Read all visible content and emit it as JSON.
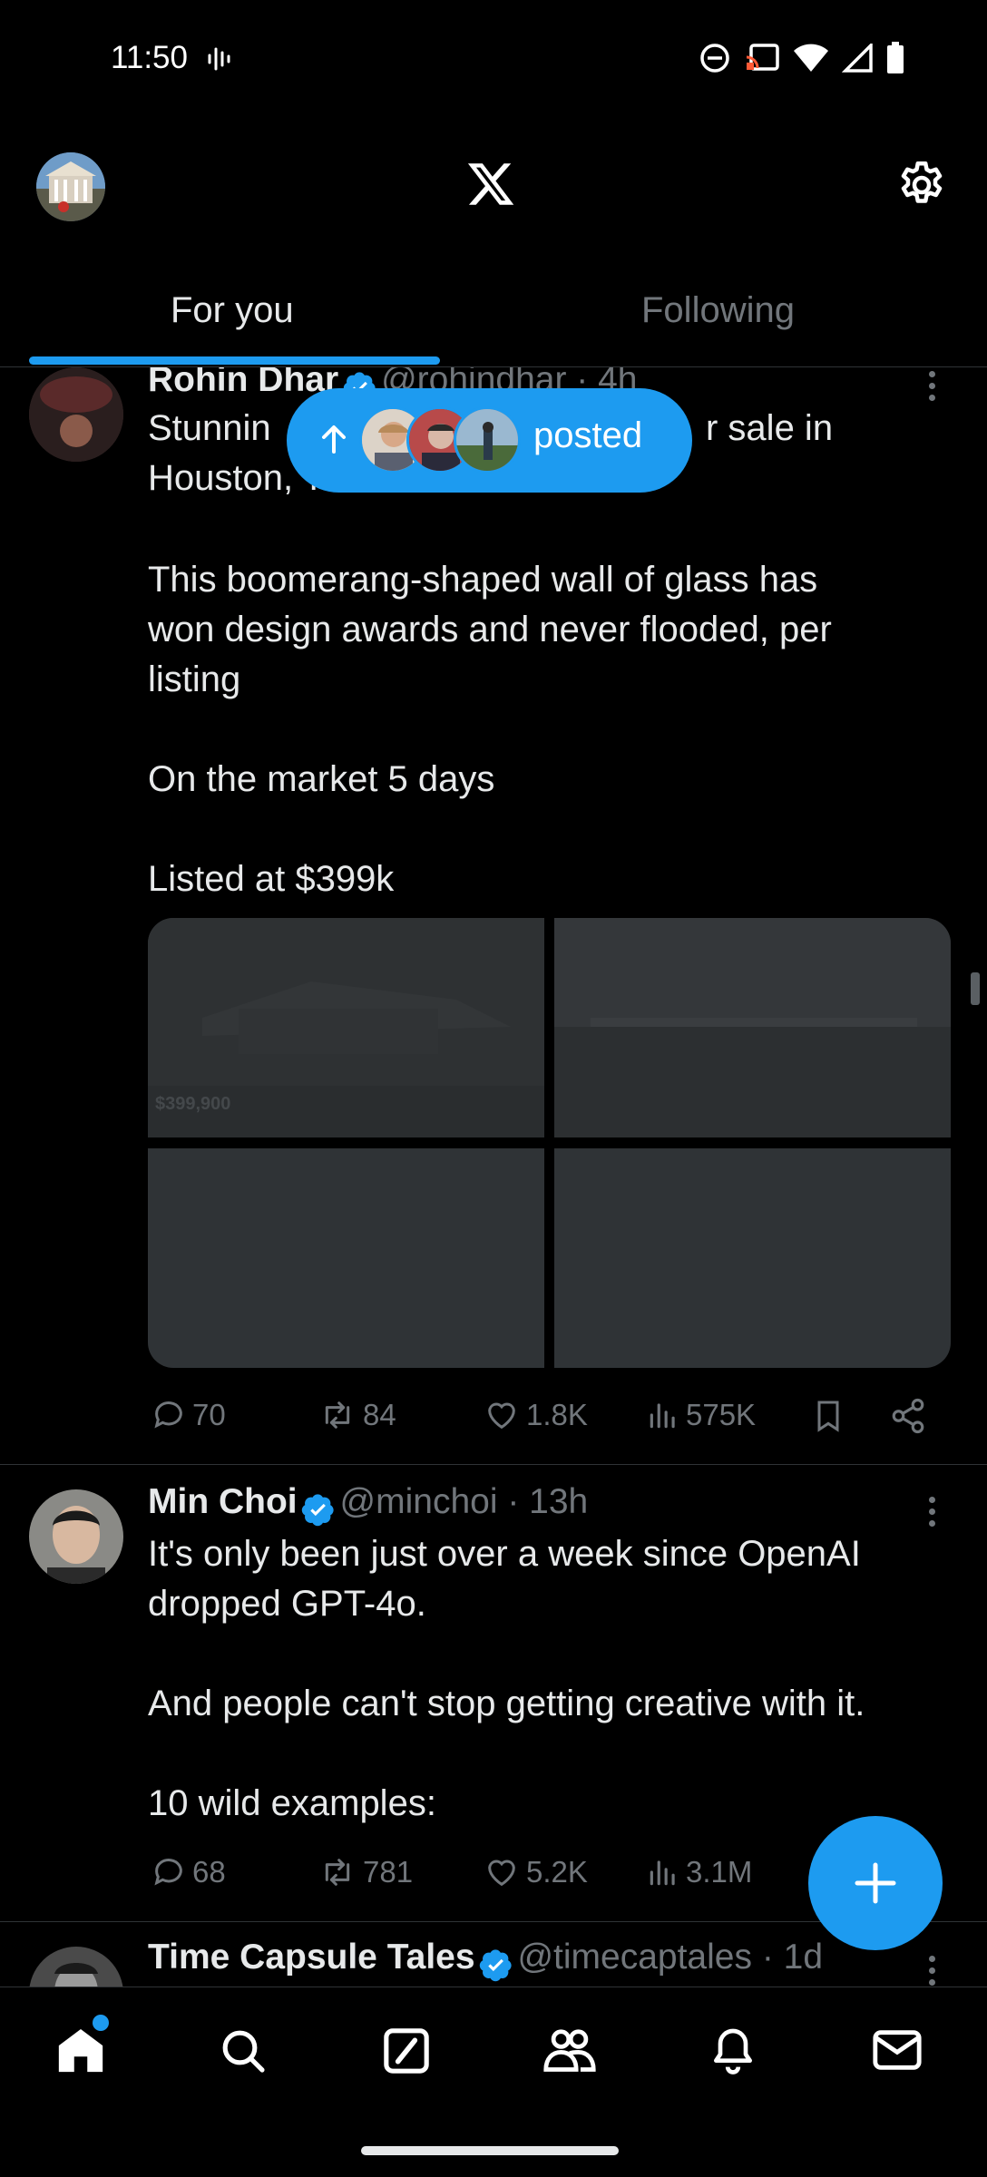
{
  "status_bar": {
    "time": "11:50"
  },
  "tabs": [
    {
      "label": "For you"
    },
    {
      "label": "Following"
    }
  ],
  "posted_pill": {
    "label": "posted"
  },
  "tweets": [
    {
      "name": "Rohin Dhar",
      "handle": "@rohindhar · 4h",
      "text_line1_a": "Stunnin",
      "text_line1_b": "r sale in",
      "text_line2": "Houston, Texas",
      "text_rest": "This boomerang-shaped wall of glass has\nwon design awards and never flooded, per\nlisting\n\nOn the market 5 days\n\nListed at $399k",
      "media_price": "$399,900",
      "stats": {
        "replies": "70",
        "reposts": "84",
        "likes": "1.8K",
        "views": "575K"
      }
    },
    {
      "name": "Min Choi",
      "handle": "@minchoi · 13h",
      "text": "It's only been just over a week since OpenAI\ndropped GPT-4o.\n\nAnd people can't stop getting creative with it.\n\n10 wild examples:",
      "stats": {
        "replies": "68",
        "reposts": "781",
        "likes": "5.2K",
        "views": "3.1M"
      }
    },
    {
      "name": "Time Capsule Tales",
      "handle": "@timecaptales · 1d"
    }
  ],
  "colors": {
    "accent": "#1d9bf0",
    "background": "#000000",
    "muted": "#71767b",
    "text": "#e7e9ea"
  }
}
